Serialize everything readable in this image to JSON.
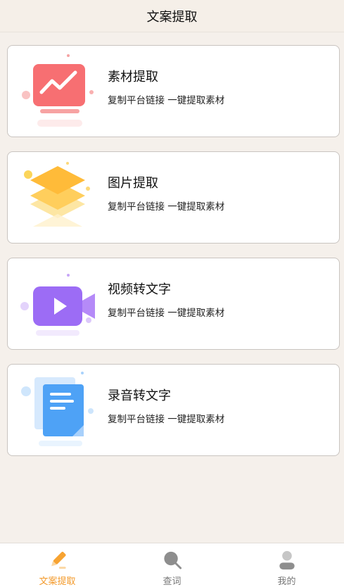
{
  "header": {
    "title": "文案提取"
  },
  "cards": [
    {
      "title": "素材提取",
      "desc": "复制平台链接 一键提取素材",
      "icon": "monitor-chart-icon"
    },
    {
      "title": "图片提取",
      "desc": "复制平台链接 一键提取素材",
      "icon": "layers-icon"
    },
    {
      "title": "视频转文字",
      "desc": "复制平台链接 一键提取素材",
      "icon": "video-camera-icon"
    },
    {
      "title": "录音转文字",
      "desc": "复制平台链接 一键提取素材",
      "icon": "document-icon"
    }
  ],
  "tabbar": {
    "items": [
      {
        "label": "文案提取",
        "icon": "pencil-icon",
        "active": true
      },
      {
        "label": "查词",
        "icon": "search-icon",
        "active": false
      },
      {
        "label": "我的",
        "icon": "user-icon",
        "active": false
      }
    ]
  },
  "colors": {
    "accent": "#f39a2b",
    "background": "#f5f0eb"
  }
}
